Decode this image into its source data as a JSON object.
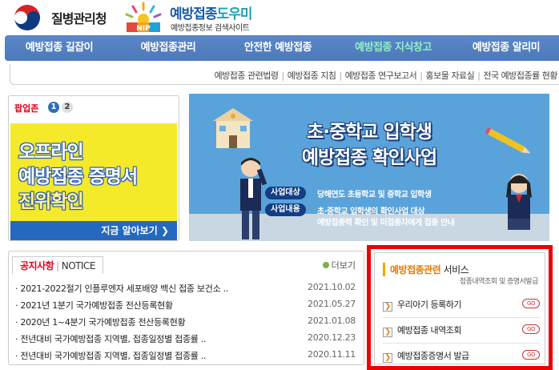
{
  "header": {
    "kdca_name": "질병관리청",
    "nip_badge": "NIP",
    "nip_title_main": "예방접종",
    "nip_title_accent": "도우미",
    "nip_subtitle": "예방접종정보 검색사이트"
  },
  "gnb": {
    "items": [
      {
        "label": "예방접종 길잡이"
      },
      {
        "label": "예방접종관리"
      },
      {
        "label": "안전한 예방접종"
      },
      {
        "label": "예방접종 지식창고",
        "active": true
      },
      {
        "label": "예방접종 알리미"
      }
    ]
  },
  "subnav": {
    "items": [
      "예방접종 관련법령",
      "예방접종 지침",
      "예방접종 연구보고서",
      "홍보물 자료실",
      "전국 예방접종률 현황"
    ]
  },
  "popup": {
    "title": "팝업존",
    "pages": [
      "1",
      "2"
    ],
    "line1": "오프라인",
    "line2": "예방접종 증명서",
    "line3": "진위확인",
    "link": "지금 알아보기 ❯"
  },
  "banner": {
    "title1": "초·중학교 입학생",
    "title2": "예방접종 확인사업",
    "label1": "사업대상",
    "text1": "당해연도 초등학교 및 중학교 입학생",
    "label2": "사업내용",
    "text2": "초·중학교 입학생의 확인사업 대상",
    "text3": "예방접종력 확인 및 미접종자에게 접종 안내"
  },
  "notice": {
    "tab_ko": "공지사항",
    "tab_en": "NOTICE",
    "more": "더보기",
    "rows": [
      {
        "title": "· 2021-2022절기 인플루엔자 세포배양 백신 접종 보건소 ..",
        "date": "2021.10.02"
      },
      {
        "title": "· 2021년 1분기 국가예방접종 전산등록현황",
        "date": "2021.05.27"
      },
      {
        "title": "· 2020년 1~4분기 국가예방접종 전산등록현황",
        "date": "2021.01.08"
      },
      {
        "title": "· 전년대비 국가예방접종 지역별, 접종일정별 접종률 ..",
        "date": "2020.12.23"
      },
      {
        "title": "· 전년대비 국가예방접종 지역별, 접종일정별 접종률 ..",
        "date": "2020.11.11"
      }
    ]
  },
  "service": {
    "title_hl": "예방접종관련",
    "title_rest": " 서비스",
    "subtitle": "접종내역조회 및 증명서발급",
    "items": [
      {
        "label": "우리아기 등록하기",
        "go": "GO"
      },
      {
        "label": "예방접종 내역조회",
        "go": "GO"
      },
      {
        "label": "예방접종증명서 발급",
        "go": "GO"
      }
    ]
  },
  "colors": {
    "gnb": "#5a87c6",
    "gnb_active": "#8ff0c8",
    "popup_yellow": "#f5ea2a",
    "banner_blue": "#5aa3da",
    "highlight_border": "#ee0000",
    "accent_red": "#e2001a"
  }
}
